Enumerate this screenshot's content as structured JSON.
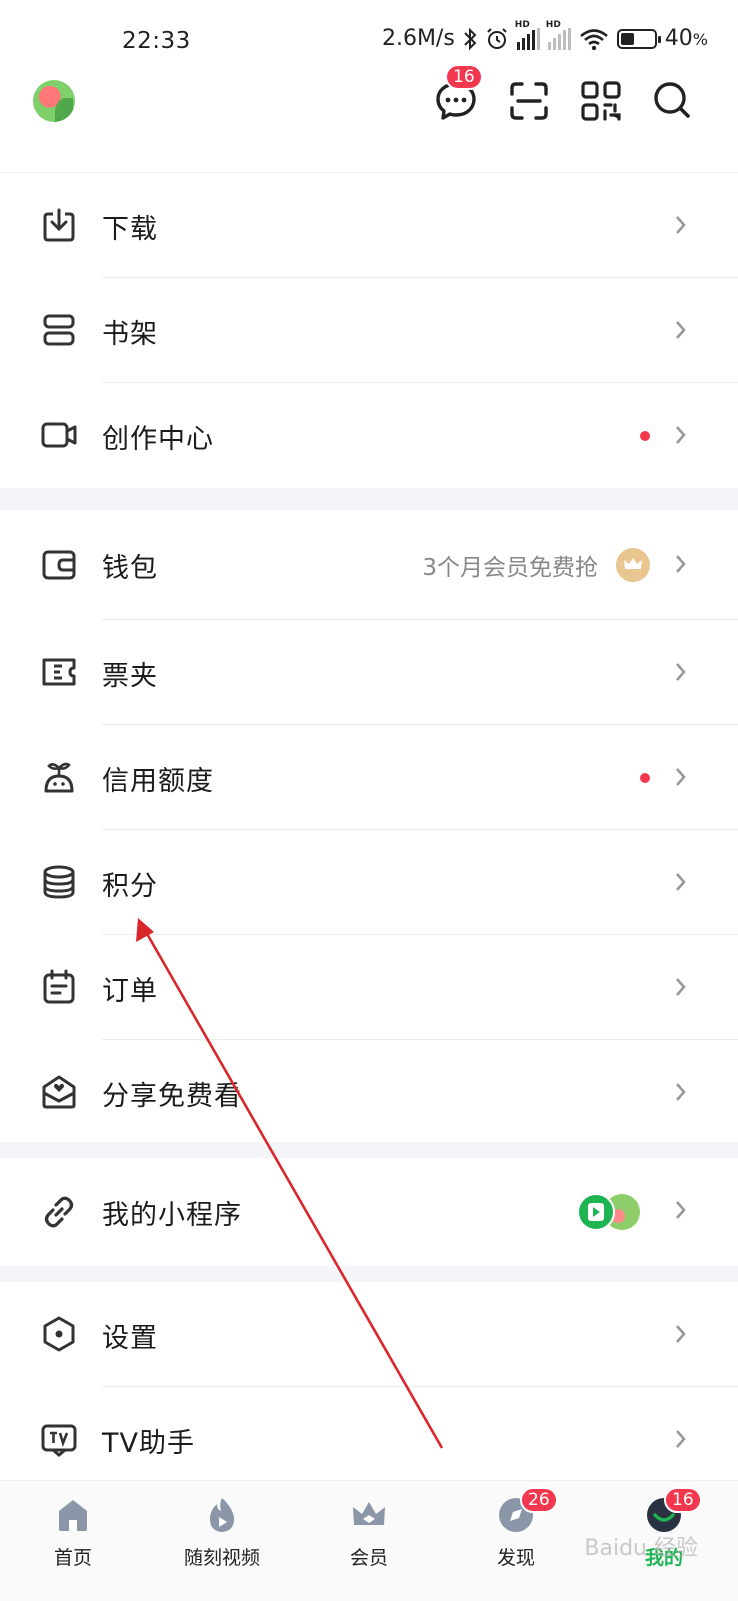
{
  "status_bar": {
    "time": "22:33",
    "speed": "2.6M/s",
    "hd_label": "HD",
    "battery_text": "40",
    "battery_unit": "%",
    "battery_level": 0.4
  },
  "header": {
    "messages_badge": "16"
  },
  "menu": {
    "download": "下载",
    "bookshelf": "书架",
    "creator_center": "创作中心",
    "wallet": "钱包",
    "wallet_promo": "3个月会员免费抢",
    "tickets": "票夹",
    "credit_limit": "信用额度",
    "points": "积分",
    "orders": "订单",
    "share_free": "分享免费看",
    "mini_programs": "我的小程序",
    "settings": "设置",
    "tv_assistant": "TV助手"
  },
  "bottom_nav": {
    "home": "首页",
    "short_video": "随刻视频",
    "vip": "会员",
    "discover": "发现",
    "discover_badge": "26",
    "mine": "我的",
    "mine_badge": "16"
  },
  "colors": {
    "accent_green": "#1fb452",
    "badge_red": "#f2374e",
    "annotation_arrow": "#d9262b"
  },
  "watermark": "Baidu 经验"
}
